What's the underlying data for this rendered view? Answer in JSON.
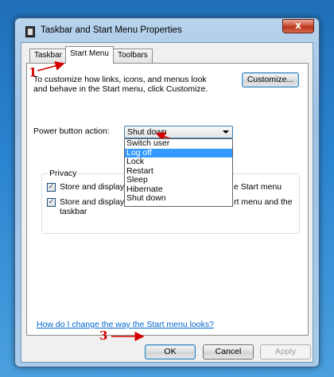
{
  "window": {
    "title": "Taskbar and Start Menu Properties",
    "close_glyph": "x"
  },
  "tabs": [
    {
      "label": "Taskbar",
      "active": false
    },
    {
      "label": "Start Menu",
      "active": true
    },
    {
      "label": "Toolbars",
      "active": false
    }
  ],
  "start_menu": {
    "description": "To customize how links, icons, and menus look and behave in the Start menu, click Customize.",
    "customize_label": "Customize...",
    "power_label": "Power button action:",
    "power_value": "Shut down",
    "power_options": [
      "Switch user",
      "Log off",
      "Lock",
      "Restart",
      "Sleep",
      "Hibernate",
      "Shut down"
    ],
    "power_selected_option": "Log off",
    "privacy": {
      "title": "Privacy",
      "items": [
        {
          "left_text": "Store and display r",
          "right_text": "e Start menu",
          "checked": true
        },
        {
          "left_text": "Store and display r",
          "right_text": "rt menu and the",
          "second_line": "taskbar",
          "checked": true
        }
      ]
    },
    "help_link": "How do I change the way the Start menu looks?"
  },
  "buttons": {
    "ok": "OK",
    "cancel": "Cancel",
    "apply": "Apply"
  },
  "annotations": {
    "step1": "1",
    "step2": "2",
    "step3": "3",
    "color": "#d40000"
  },
  "colors": {
    "selection": "#3399ff",
    "link": "#0066cc",
    "close_button": "#c8462e"
  }
}
